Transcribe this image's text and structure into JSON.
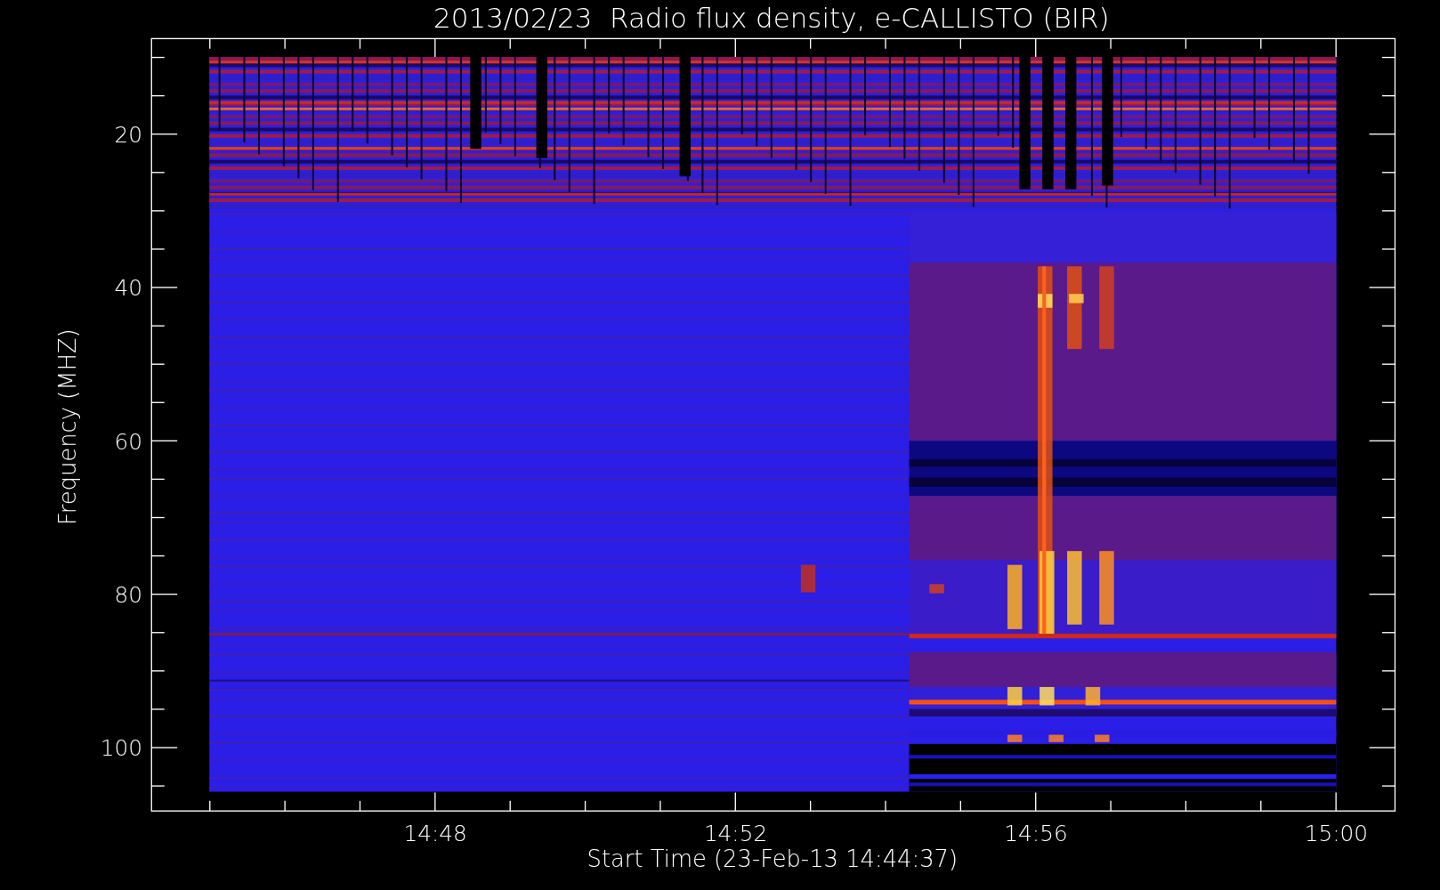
{
  "chart": {
    "title": "2013/02/23  Radio flux density, e-CALLISTO (BIR)",
    "ylabel": "Frequency (MHZ)",
    "yticks": [
      "20",
      "40",
      "60",
      "80",
      "100"
    ],
    "xticks": [
      "14:48",
      "14:52",
      "14:56",
      "15:00"
    ],
    "xlabel": "Start Time (23-Feb-13 14:44:37)"
  }
}
